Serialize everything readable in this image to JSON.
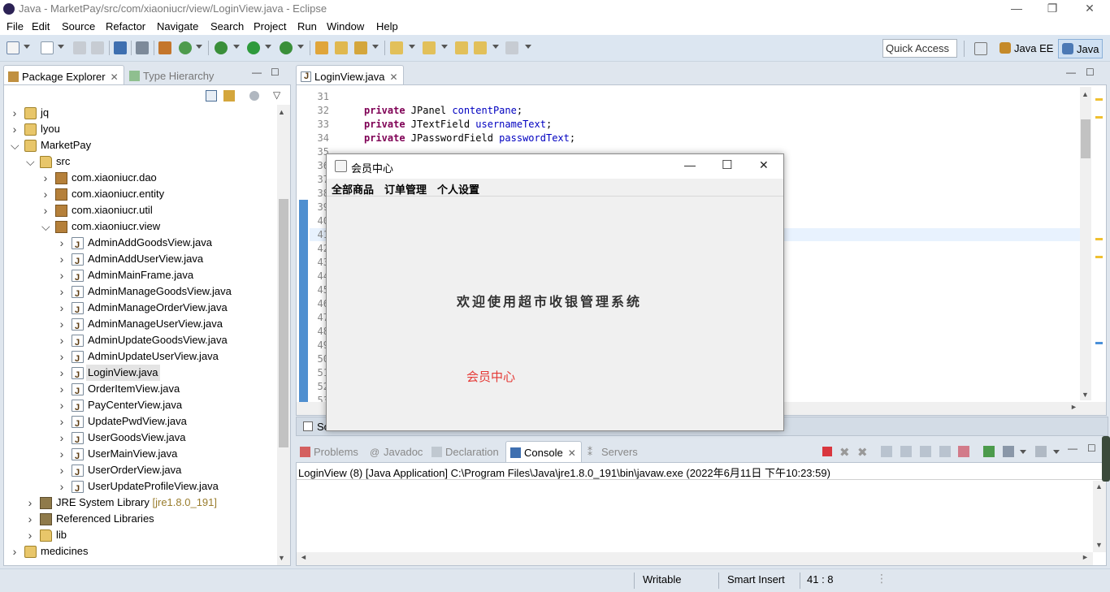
{
  "window": {
    "title": "Java - MarketPay/src/com/xiaoniucr/view/LoginView.java - Eclipse",
    "minimize": "—",
    "restore": "❐",
    "close": "✕"
  },
  "menubar": [
    "File",
    "Edit",
    "Source",
    "Refactor",
    "Navigate",
    "Search",
    "Project",
    "Run",
    "Window",
    "Help"
  ],
  "toolbar": {
    "quick_access": "Quick Access",
    "perspectives": [
      "Java EE",
      "Java"
    ]
  },
  "package_explorer": {
    "tabs": [
      "Package Explorer",
      "Type Hierarchy"
    ],
    "tree": [
      {
        "label": "jq",
        "type": "project",
        "indent": 0,
        "twisty": ">"
      },
      {
        "label": "lyou",
        "type": "project",
        "indent": 0,
        "twisty": ">"
      },
      {
        "label": "MarketPay",
        "type": "project",
        "indent": 0,
        "twisty": "v"
      },
      {
        "label": "src",
        "type": "folder",
        "indent": 1,
        "twisty": "v"
      },
      {
        "label": "com.xiaoniucr.dao",
        "type": "package",
        "indent": 2,
        "twisty": ">"
      },
      {
        "label": "com.xiaoniucr.entity",
        "type": "package",
        "indent": 2,
        "twisty": ">"
      },
      {
        "label": "com.xiaoniucr.util",
        "type": "package",
        "indent": 2,
        "twisty": ">"
      },
      {
        "label": "com.xiaoniucr.view",
        "type": "package",
        "indent": 2,
        "twisty": "v"
      },
      {
        "label": "AdminAddGoodsView.java",
        "type": "java",
        "indent": 3,
        "twisty": ">"
      },
      {
        "label": "AdminAddUserView.java",
        "type": "java",
        "indent": 3,
        "twisty": ">"
      },
      {
        "label": "AdminMainFrame.java",
        "type": "java",
        "indent": 3,
        "twisty": ">"
      },
      {
        "label": "AdminManageGoodsView.java",
        "type": "java",
        "indent": 3,
        "twisty": ">"
      },
      {
        "label": "AdminManageOrderView.java",
        "type": "java",
        "indent": 3,
        "twisty": ">"
      },
      {
        "label": "AdminManageUserView.java",
        "type": "java",
        "indent": 3,
        "twisty": ">"
      },
      {
        "label": "AdminUpdateGoodsView.java",
        "type": "java",
        "indent": 3,
        "twisty": ">"
      },
      {
        "label": "AdminUpdateUserView.java",
        "type": "java",
        "indent": 3,
        "twisty": ">"
      },
      {
        "label": "LoginView.java",
        "type": "java",
        "indent": 3,
        "twisty": ">",
        "selected": true
      },
      {
        "label": "OrderItemView.java",
        "type": "java",
        "indent": 3,
        "twisty": ">"
      },
      {
        "label": "PayCenterView.java",
        "type": "java",
        "indent": 3,
        "twisty": ">"
      },
      {
        "label": "UpdatePwdView.java",
        "type": "java",
        "indent": 3,
        "twisty": ">"
      },
      {
        "label": "UserGoodsView.java",
        "type": "java",
        "indent": 3,
        "twisty": ">"
      },
      {
        "label": "UserMainView.java",
        "type": "java",
        "indent": 3,
        "twisty": ">"
      },
      {
        "label": "UserOrderView.java",
        "type": "java",
        "indent": 3,
        "twisty": ">"
      },
      {
        "label": "UserUpdateProfileView.java",
        "type": "java",
        "indent": 3,
        "twisty": ">"
      },
      {
        "label": "JRE System Library",
        "suffix": "[jre1.8.0_191]",
        "type": "lib",
        "indent": 1,
        "twisty": ">"
      },
      {
        "label": "Referenced Libraries",
        "type": "lib",
        "indent": 1,
        "twisty": ">"
      },
      {
        "label": "lib",
        "type": "folder",
        "indent": 1,
        "twisty": ">"
      },
      {
        "label": "medicines",
        "type": "project",
        "indent": 0,
        "twisty": ">"
      }
    ]
  },
  "editor": {
    "tab": "LoginView.java",
    "lines": [
      {
        "n": "31",
        "code": []
      },
      {
        "n": "32",
        "code": [
          [
            "kw",
            "private"
          ],
          [
            "t",
            " JPanel "
          ],
          [
            "fld",
            "contentPane"
          ],
          [
            "t",
            ";"
          ]
        ]
      },
      {
        "n": "33",
        "code": [
          [
            "kw",
            "private"
          ],
          [
            "t",
            " JTextField "
          ],
          [
            "fld",
            "usernameText"
          ],
          [
            "t",
            ";"
          ]
        ]
      },
      {
        "n": "34",
        "code": [
          [
            "kw",
            "private"
          ],
          [
            "t",
            " JPasswordField "
          ],
          [
            "fld",
            "passwordText"
          ],
          [
            "t",
            ";"
          ]
        ]
      },
      {
        "n": "35",
        "code": []
      },
      {
        "n": "36",
        "code": []
      },
      {
        "n": "37",
        "code": []
      },
      {
        "n": "38",
        "code": []
      },
      {
        "n": "39",
        "code": []
      },
      {
        "n": "40",
        "code": []
      },
      {
        "n": "41",
        "code": []
      },
      {
        "n": "42",
        "code": []
      },
      {
        "n": "43",
        "code": []
      },
      {
        "n": "44",
        "code": []
      },
      {
        "n": "45",
        "code": []
      },
      {
        "n": "46",
        "code": []
      },
      {
        "n": "47",
        "code": []
      },
      {
        "n": "48",
        "code": []
      },
      {
        "n": "49",
        "code": []
      },
      {
        "n": "50",
        "code": []
      },
      {
        "n": "51",
        "code": []
      },
      {
        "n": "52",
        "code": []
      },
      {
        "n": "53",
        "code": []
      }
    ]
  },
  "bottom": {
    "hidden_tab": "So",
    "tabs": [
      "Problems",
      "Javadoc",
      "Declaration",
      "Console",
      "Servers"
    ],
    "console_header": "LoginView (8) [Java Application] C:\\Program Files\\Java\\jre1.8.0_191\\bin\\javaw.exe (2022年6月11日 下午10:23:59)"
  },
  "statusbar": {
    "writable": "Writable",
    "insert_mode": "Smart Insert",
    "position": "41 : 8"
  },
  "dialog": {
    "title": "会员中心",
    "menus": [
      "全部商品",
      "订单管理",
      "个人设置"
    ],
    "welcome": "欢迎使用超市收银管理系统",
    "label": "会员中心",
    "label_color": "#e53935",
    "minimize": "—",
    "maximize": "☐",
    "close": "✕"
  }
}
